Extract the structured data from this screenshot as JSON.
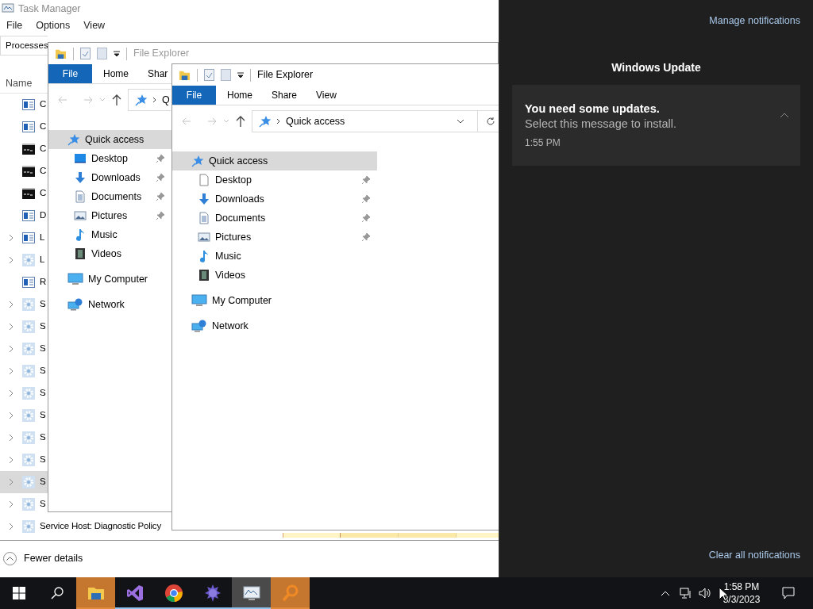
{
  "task_manager": {
    "title": "Task Manager",
    "active": false,
    "menu": [
      "File",
      "Options",
      "View"
    ],
    "tabs": [
      {
        "label": "Processes",
        "selected": true
      }
    ],
    "column_name": "Name",
    "rows": [
      {
        "name": "C",
        "kind": "app",
        "expandable": false,
        "selected": false
      },
      {
        "name": "C",
        "kind": "app",
        "expandable": false,
        "selected": false
      },
      {
        "name": "C",
        "kind": "console",
        "expandable": false,
        "selected": false
      },
      {
        "name": "C",
        "kind": "console",
        "expandable": false,
        "selected": false
      },
      {
        "name": "C",
        "kind": "console",
        "expandable": false,
        "selected": false
      },
      {
        "name": "D",
        "kind": "app",
        "expandable": false,
        "selected": false
      },
      {
        "name": "L",
        "kind": "app",
        "expandable": true,
        "selected": false
      },
      {
        "name": "L",
        "kind": "service",
        "expandable": true,
        "selected": false
      },
      {
        "name": "R",
        "kind": "app",
        "expandable": false,
        "selected": false
      },
      {
        "name": "S",
        "kind": "service",
        "expandable": true,
        "selected": false
      },
      {
        "name": "S",
        "kind": "service",
        "expandable": true,
        "selected": false
      },
      {
        "name": "S",
        "kind": "service",
        "expandable": true,
        "selected": false
      },
      {
        "name": "S",
        "kind": "service",
        "expandable": true,
        "selected": false
      },
      {
        "name": "S",
        "kind": "service",
        "expandable": true,
        "selected": false
      },
      {
        "name": "S",
        "kind": "service",
        "expandable": true,
        "selected": false
      },
      {
        "name": "S",
        "kind": "service",
        "expandable": true,
        "selected": false
      },
      {
        "name": "S",
        "kind": "service",
        "expandable": true,
        "selected": false
      },
      {
        "name": "S",
        "kind": "service",
        "expandable": true,
        "selected": true
      },
      {
        "name": "S",
        "kind": "service",
        "expandable": true,
        "selected": false
      },
      {
        "name": "Service Host: Diagnostic Policy",
        "kind": "service",
        "expandable": true,
        "selected": false
      }
    ],
    "fewer_details": "Fewer details"
  },
  "explorers": [
    {
      "title": "File Explorer",
      "active": false,
      "ribbon_tabs": [
        {
          "label": "File",
          "kind": "file"
        },
        {
          "label": "Home",
          "kind": "tab"
        },
        {
          "label": "Shar",
          "kind": "tab"
        }
      ],
      "address": "Q",
      "nav": [
        {
          "label": "Quick access",
          "kind": "star",
          "selected": true,
          "children": [
            {
              "label": "Desktop",
              "kind": "desktop",
              "pinned": true,
              "selected": false
            },
            {
              "label": "Downloads",
              "kind": "download",
              "pinned": true,
              "selected": false
            },
            {
              "label": "Documents",
              "kind": "documents",
              "pinned": true,
              "selected": false
            },
            {
              "label": "Pictures",
              "kind": "pictures",
              "pinned": true,
              "selected": false
            },
            {
              "label": "Music",
              "kind": "music",
              "pinned": false,
              "selected": false
            },
            {
              "label": "Videos",
              "kind": "videos",
              "pinned": false,
              "selected": false
            }
          ]
        },
        {
          "label": "My Computer",
          "kind": "computer",
          "selected": false
        },
        {
          "label": "Network",
          "kind": "network",
          "selected": false
        }
      ]
    },
    {
      "title": "File Explorer",
      "active": true,
      "ribbon_tabs": [
        {
          "label": "File",
          "kind": "file"
        },
        {
          "label": "Home",
          "kind": "tab"
        },
        {
          "label": "Share",
          "kind": "tab"
        },
        {
          "label": "View",
          "kind": "tab"
        }
      ],
      "address": "Quick access",
      "nav": [
        {
          "label": "Quick access",
          "kind": "star",
          "selected": true,
          "children": [
            {
              "label": "Desktop",
              "kind": "page",
              "pinned": true,
              "selected": false
            },
            {
              "label": "Downloads",
              "kind": "download",
              "pinned": true,
              "selected": false
            },
            {
              "label": "Documents",
              "kind": "documents",
              "pinned": true,
              "selected": false
            },
            {
              "label": "Pictures",
              "kind": "pictures",
              "pinned": true,
              "selected": false
            },
            {
              "label": "Music",
              "kind": "music",
              "pinned": false,
              "selected": false
            },
            {
              "label": "Videos",
              "kind": "videos",
              "pinned": false,
              "selected": false
            }
          ]
        },
        {
          "label": "My Computer",
          "kind": "computer",
          "selected": false
        },
        {
          "label": "Network",
          "kind": "network",
          "selected": false
        }
      ]
    }
  ],
  "notifications": {
    "manage": "Manage notifications",
    "group": "Windows Update",
    "items": [
      {
        "title": "You need some updates.",
        "body": "Select this message to install.",
        "time": "1:55 PM",
        "expanded": true
      }
    ],
    "clear": "Clear all notifications"
  },
  "taskbar": {
    "apps": [
      {
        "kind": "folder",
        "highlighted": true,
        "selected": false
      },
      {
        "kind": "studio",
        "highlighted": false,
        "selected": false
      },
      {
        "kind": "browser",
        "highlighted": false,
        "selected": false
      },
      {
        "kind": "ball",
        "highlighted": false,
        "selected": false
      },
      {
        "kind": "monitor",
        "highlighted": false,
        "selected": true
      },
      {
        "kind": "magnifier",
        "highlighted": true,
        "selected": false
      }
    ],
    "time": "1:58 PM",
    "date": "3/3/2023"
  }
}
